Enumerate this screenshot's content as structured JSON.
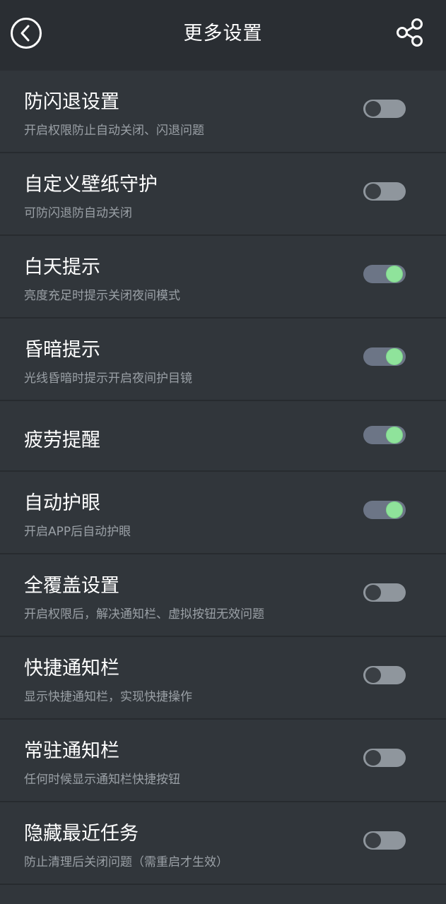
{
  "header": {
    "title": "更多设置",
    "back_icon": "chevron-left-circle-icon",
    "share_icon": "share-icon"
  },
  "colors": {
    "header_bg": "#2a2e33",
    "page_bg": "#31363b",
    "toggle_on_knob": "#8fe39b",
    "toggle_on_track": "#6c7586",
    "toggle_off_track": "#8f969d"
  },
  "settings": [
    {
      "title": "防闪退设置",
      "subtitle": "开启权限防止自动关闭、闪退问题",
      "enabled": false
    },
    {
      "title": "自定义壁纸守护",
      "subtitle": "可防闪退防自动关闭",
      "enabled": false
    },
    {
      "title": "白天提示",
      "subtitle": "亮度充足时提示关闭夜间模式",
      "enabled": true
    },
    {
      "title": "昏暗提示",
      "subtitle": "光线昏暗时提示开启夜间护目镜",
      "enabled": true
    },
    {
      "title": "疲劳提醒",
      "subtitle": "",
      "enabled": true
    },
    {
      "title": "自动护眼",
      "subtitle": "开启APP后自动护眼",
      "enabled": true
    },
    {
      "title": "全覆盖设置",
      "subtitle": "开启权限后，解决通知栏、虚拟按钮无效问题",
      "enabled": false
    },
    {
      "title": "快捷通知栏",
      "subtitle": "显示快捷通知栏，实现快捷操作",
      "enabled": false
    },
    {
      "title": "常驻通知栏",
      "subtitle": "任何时候显示通知栏快捷按钮",
      "enabled": false
    },
    {
      "title": "隐藏最近任务",
      "subtitle": "防止清理后关闭问题（需重启才生效）",
      "enabled": false
    }
  ]
}
